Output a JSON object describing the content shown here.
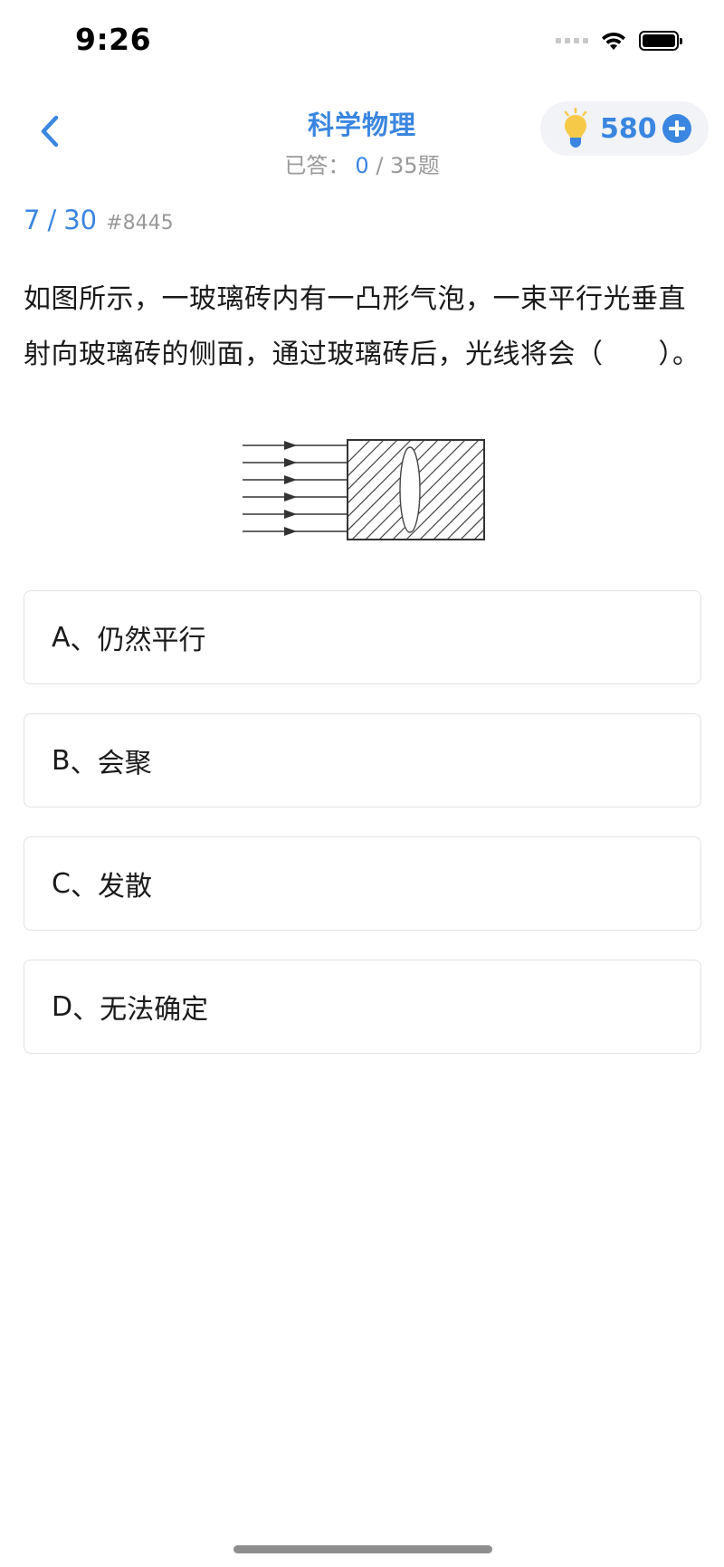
{
  "status_bar": {
    "time": "9:26",
    "icons": [
      "signal-icon",
      "wifi-icon",
      "battery-icon"
    ]
  },
  "nav": {
    "title": "科学物理",
    "answered_label": "已答：",
    "answered_count": "0",
    "total_suffix": " / 35题",
    "coins": "580",
    "icons": [
      "back-chevron-icon",
      "lightbulb-icon",
      "plus-icon"
    ]
  },
  "question": {
    "current": "7",
    "separator": "/",
    "total": "30",
    "id": "#8445",
    "text": "如图所示，一玻璃砖内有一凸形气泡，一束平行光垂直射向玻璃砖的侧面，通过玻璃砖后，光线将会（　　）。"
  },
  "options": [
    {
      "letter": "A",
      "sep": "、",
      "text": "仍然平行"
    },
    {
      "letter": "B",
      "sep": "、",
      "text": "会聚"
    },
    {
      "letter": "C",
      "sep": "、",
      "text": "发散"
    },
    {
      "letter": "D",
      "sep": "、",
      "text": "无法确定"
    }
  ],
  "colors": {
    "accent": "#3a86e0",
    "muted": "#999999",
    "option_border": "#e3e3e3",
    "pill_bg": "#f1f3f6",
    "bulb_yellow": "#f7c948",
    "bulb_base": "#3a86e0"
  }
}
